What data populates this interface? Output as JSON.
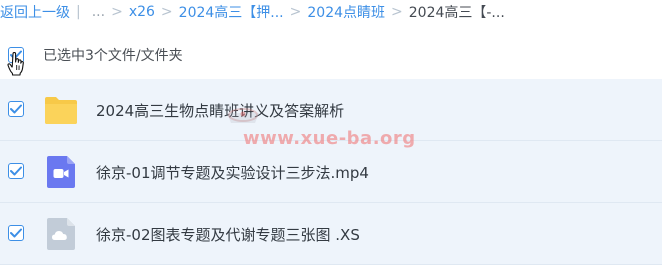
{
  "breadcrumb": {
    "back_label": "返回上一级",
    "ellipsis": "...",
    "separator": ">",
    "items": [
      "x26",
      "2024高三【押...",
      "2024点睛班"
    ],
    "current": "2024高三【-..."
  },
  "selection": {
    "count_text": "已选中3个文件/文件夹",
    "all_checked": true
  },
  "files": [
    {
      "name": "2024高三生物点睛班讲义及答案解析",
      "type": "folder",
      "icon": "folder-icon",
      "checked": true
    },
    {
      "name": "徐京-01调节专题及实验设计三步法.mp4",
      "type": "video",
      "icon": "video-file-icon",
      "checked": true
    },
    {
      "name": "徐京-02图表专题及代谢专题三张图 .XS",
      "type": "cloud",
      "icon": "cloud-file-icon",
      "checked": true
    }
  ],
  "watermark": {
    "text": "www.xue-ba.org"
  },
  "colors": {
    "accent": "#3d8fe6",
    "row_selected_bg": "#eef4fb",
    "folder": "#f7c948",
    "video": "#6a78f0",
    "cloud_doc": "#c2ccd8"
  }
}
